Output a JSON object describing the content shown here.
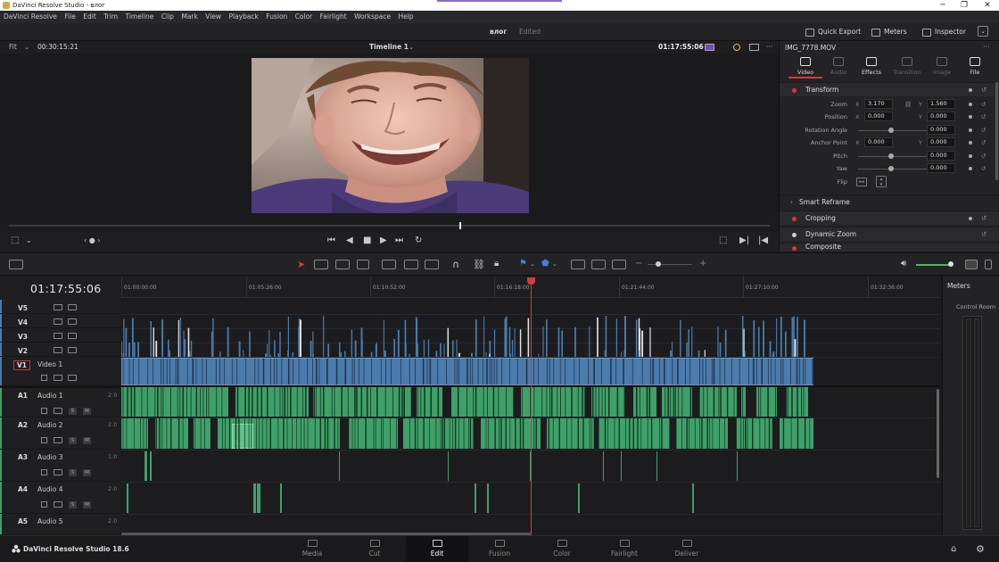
{
  "window": {
    "title": "DaVinci Resolve Studio - влог",
    "controls": [
      "─",
      "❐",
      "✕"
    ]
  },
  "menu": [
    "DaVinci Resolve",
    "File",
    "Edit",
    "Trim",
    "Timeline",
    "Clip",
    "Mark",
    "View",
    "Playback",
    "Fusion",
    "Color",
    "Fairlight",
    "Workspace",
    "Help"
  ],
  "project": {
    "name": "влог",
    "status": "Edited"
  },
  "top_buttons": {
    "quick_export": "Quick Export",
    "meters": "Meters",
    "inspector": "Inspector"
  },
  "viewer": {
    "fit": "Fit",
    "source_tc": "00:30:15:21",
    "timeline_name": "Timeline 1",
    "record_tc": "01:17:55:06"
  },
  "inspector": {
    "clip_name": "IMG_7778.MOV",
    "tabs": [
      "Video",
      "Audio",
      "Effects",
      "Transition",
      "Image",
      "File"
    ],
    "sections": {
      "transform": "Transform",
      "smart_reframe": "Smart Reframe",
      "cropping": "Cropping",
      "dynamic_zoom": "Dynamic Zoom",
      "composite": "Composite"
    },
    "params": {
      "zoom": {
        "label": "Zoom",
        "x": "3.170",
        "y": "1.560"
      },
      "position": {
        "label": "Position",
        "x": "0.000",
        "y": "0.000"
      },
      "rotation": {
        "label": "Rotation Angle",
        "value": "0.000"
      },
      "anchor": {
        "label": "Anchor Point",
        "x": "0.000",
        "y": "0.000"
      },
      "pitch": {
        "label": "Pitch",
        "value": "0.000"
      },
      "yaw": {
        "label": "Yaw",
        "value": "0.000"
      },
      "flip": {
        "label": "Flip"
      }
    },
    "axis_x": "X",
    "axis_y": "Y"
  },
  "timeline": {
    "timecode": "01:17:55:06",
    "ruler": [
      "01:00:00:00",
      "01:05:26:00",
      "01:10:52:00",
      "01:16:18:00",
      "01:21:44:00",
      "01:27:10:00",
      "01:32:36:00"
    ],
    "video_tracks": [
      {
        "id": "V5",
        "name": ""
      },
      {
        "id": "V4",
        "name": ""
      },
      {
        "id": "V3",
        "name": ""
      },
      {
        "id": "V2",
        "name": ""
      },
      {
        "id": "V1",
        "name": "Video 1"
      }
    ],
    "audio_tracks": [
      {
        "id": "A1",
        "name": "Audio 1",
        "vol": "2.0"
      },
      {
        "id": "A2",
        "name": "Audio 2",
        "vol": "2.0"
      },
      {
        "id": "A3",
        "name": "Audio 3",
        "vol": "1.0"
      },
      {
        "id": "A4",
        "name": "Audio 4",
        "vol": "2.0"
      },
      {
        "id": "A5",
        "name": "Audio 5",
        "vol": "2.0"
      }
    ],
    "sm": {
      "s": "S",
      "m": "M"
    },
    "clip_tag": "2..."
  },
  "meters": {
    "title": "Meters",
    "control_room": "Control Room"
  },
  "pages": [
    "Media",
    "Cut",
    "Edit",
    "Fusion",
    "Color",
    "Fairlight",
    "Deliver"
  ],
  "active_page": "Edit",
  "brand": "DaVinci Resolve Studio 18.6",
  "colors": {
    "video_clip": "#4b7bab",
    "audio_clip": "#3fa06a",
    "playhead": "#d9383c",
    "accent": "#e0343a"
  }
}
